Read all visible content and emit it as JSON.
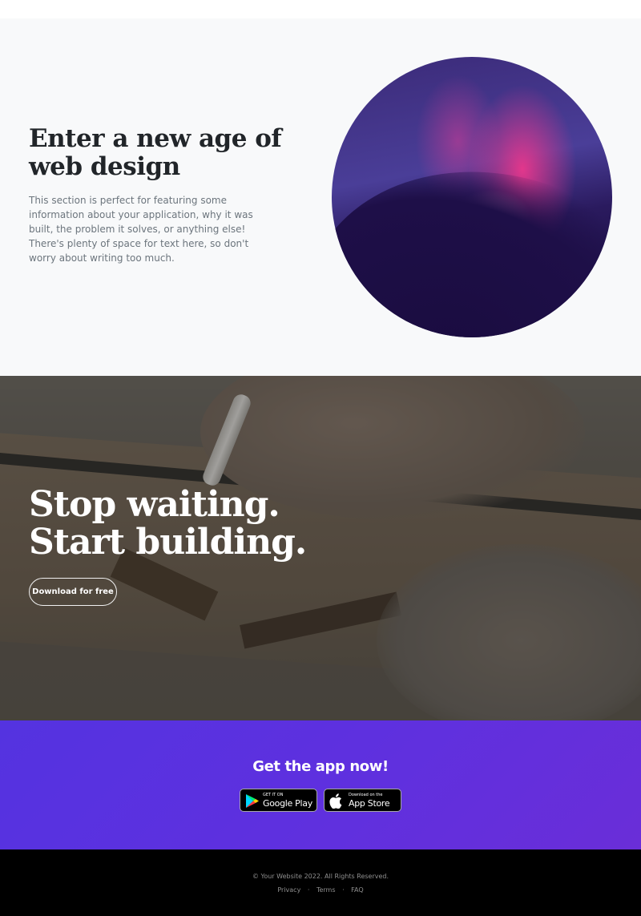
{
  "feature": {
    "heading_line1": "Enter a new age of",
    "heading_line2": "web design",
    "text": "This section is perfect for featuring some information about your application, why it was built, the problem it solves, or anything else! There's plenty of space for text here, so don't worry about writing too much."
  },
  "cta": {
    "heading_line1": "Stop waiting.",
    "heading_line2": "Start building.",
    "button_label": "Download for free"
  },
  "app": {
    "title": "Get the app now!",
    "google": {
      "small": "GET IT ON",
      "big": "Google Play",
      "icon": "google-play-icon"
    },
    "apple": {
      "small": "Download on the",
      "big": "App Store",
      "icon": "apple-icon"
    }
  },
  "footer": {
    "copyright": "© Your Website 2022. All Rights Reserved.",
    "links": [
      "Privacy",
      "Terms",
      "FAQ"
    ],
    "separator": "·"
  },
  "colors": {
    "app_section": "#5e30df",
    "footer_bg": "#000000",
    "feature_bg": "#f8f9fa"
  }
}
